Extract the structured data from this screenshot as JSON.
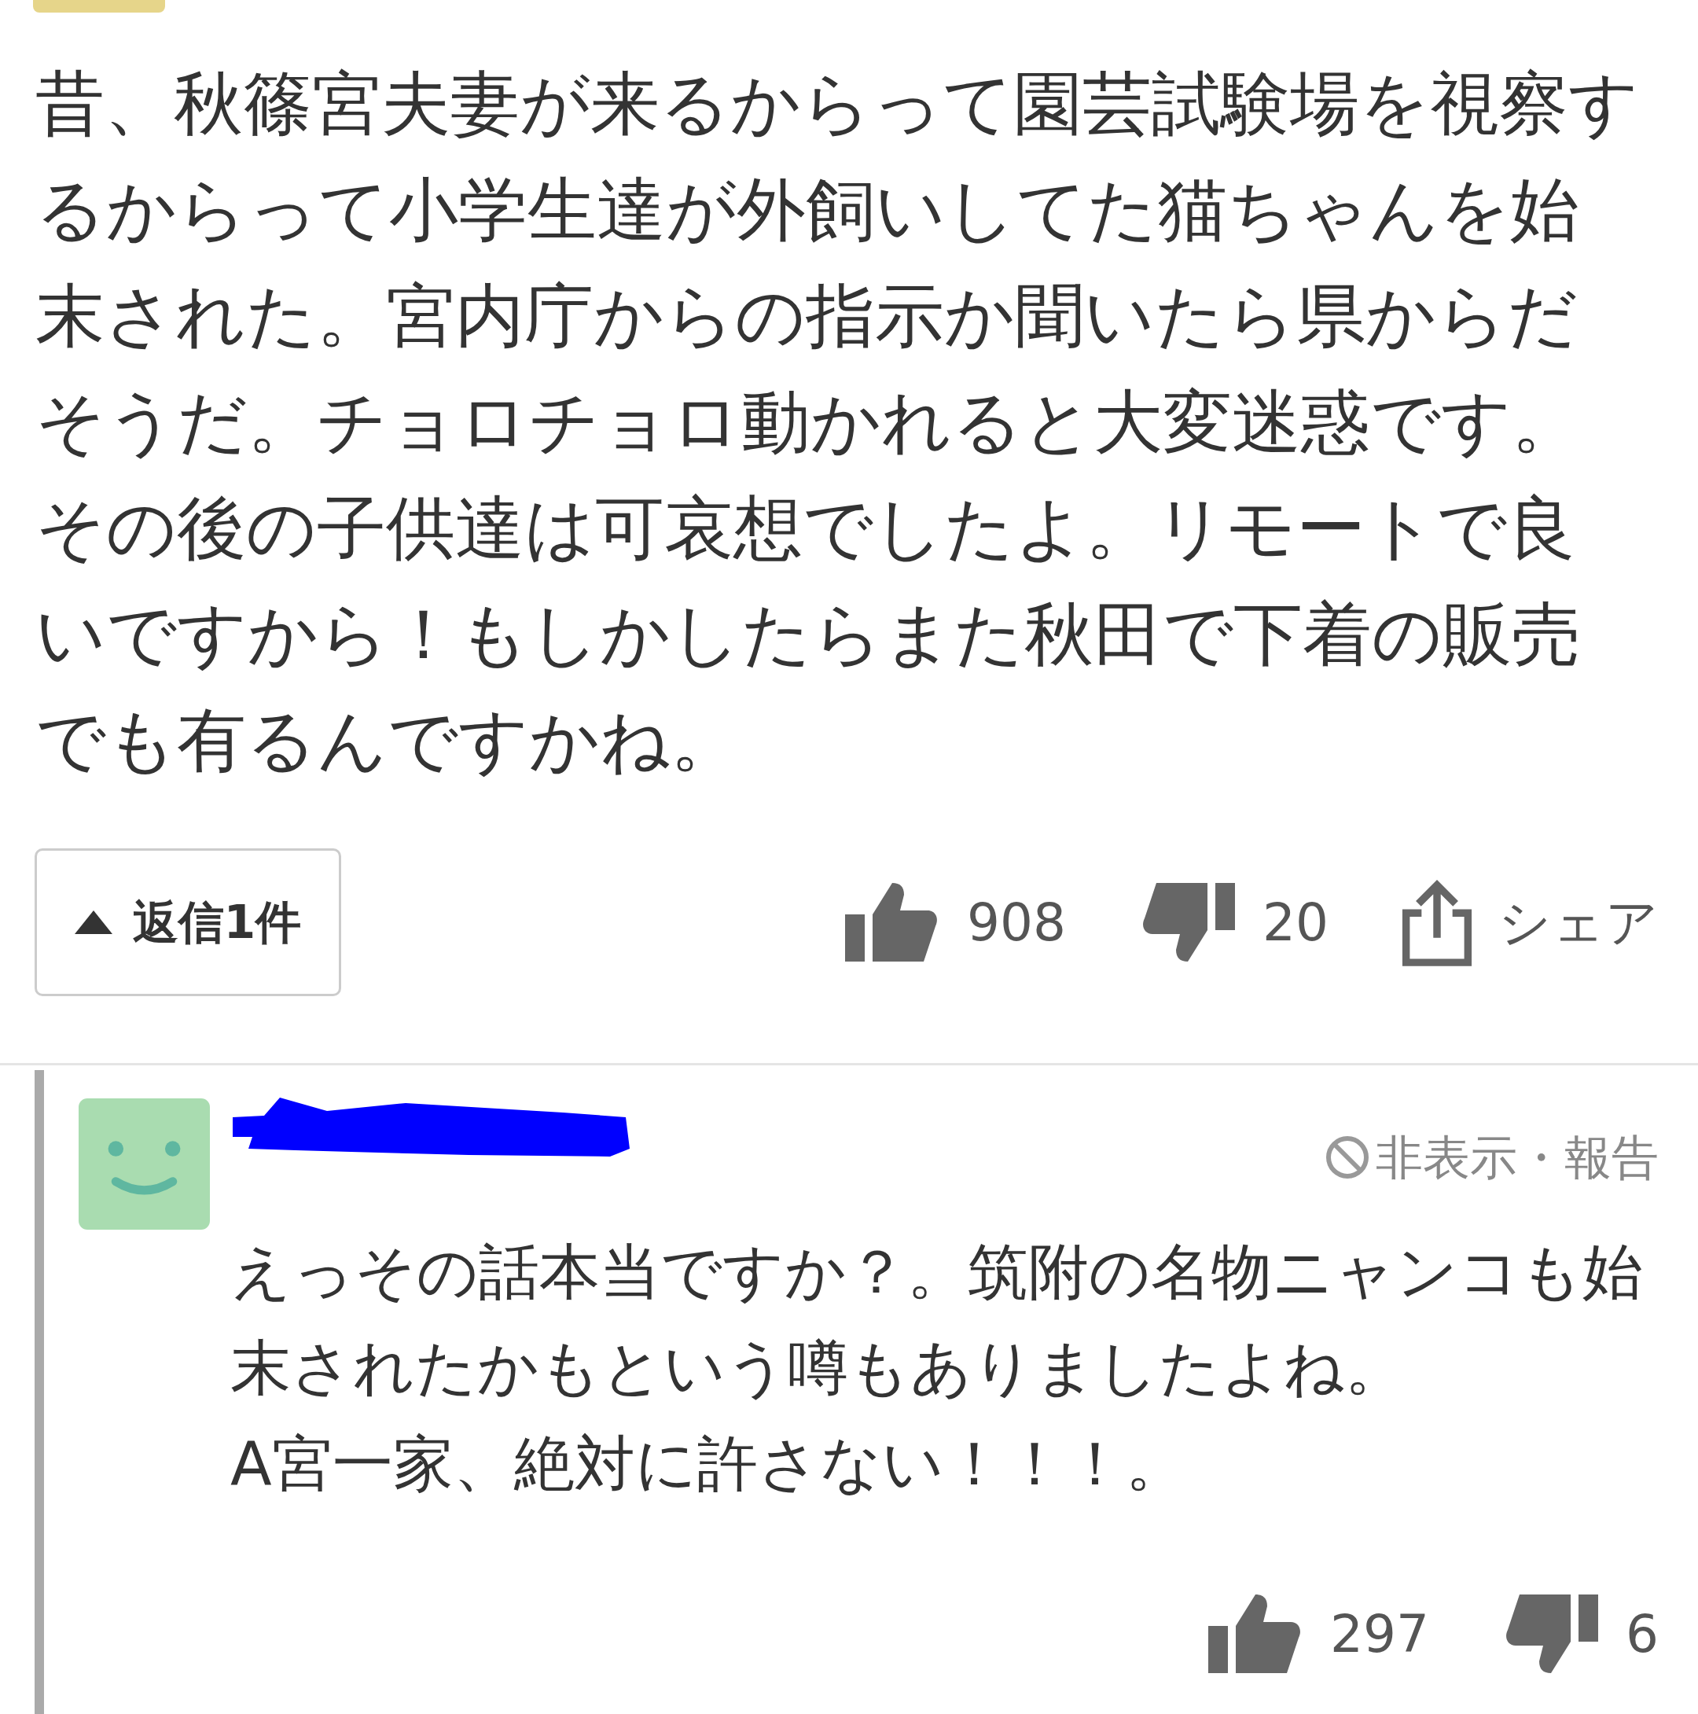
{
  "comment": {
    "text": "昔、秋篠宮夫妻が来るからって園芸試験場を視察するからって小学生達が外飼いしてた猫ちゃんを始末された。宮内庁からの指示か聞いたら県からだそうだ。チョロチョロ動かれると大変迷惑です。その後の子供達は可哀想でしたよ。リモートで良いですから！もしかしたらまた秋田で下着の販売でも有るんですかね。",
    "replies_button": {
      "label": "返信1件",
      "expanded": true
    },
    "likes": "908",
    "dislikes": "20",
    "share": "シェア"
  },
  "reply": {
    "text": "えっその話本当ですか？。筑附の名物ニャンコも始末されたかもという噂もありましたよね。\nA宮一家、絶対に許さない！！！。",
    "hide_report": "非表示・報告",
    "likes": "297",
    "dislikes": "6"
  }
}
